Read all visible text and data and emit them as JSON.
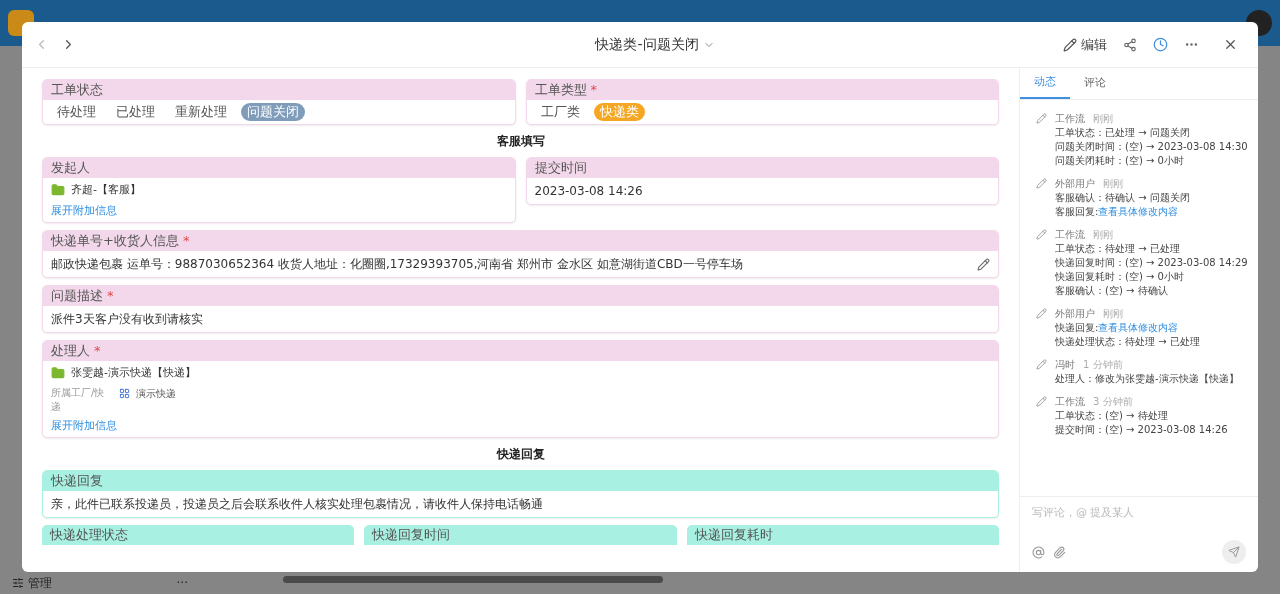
{
  "background": {
    "footer_label": "管理",
    "footer_more": "···"
  },
  "modal": {
    "title": "快递类-问题关闭",
    "edit": "编辑"
  },
  "form": [
    {
      "kind": "row",
      "fields": [
        {
          "kind": "options",
          "label": "工单状态",
          "color": "#f2d8ea",
          "options": [
            {
              "label": "待处理",
              "selected": false
            },
            {
              "label": "已处理",
              "selected": false
            },
            {
              "label": "重新处理",
              "selected": false
            },
            {
              "label": "问题关闭",
              "selected": true,
              "color": "#7f9dbb"
            }
          ]
        },
        {
          "kind": "options",
          "label": "工单类型",
          "required_mark": "*",
          "color": "#f2d8ea",
          "options": [
            {
              "label": "工厂类",
              "selected": false
            },
            {
              "label": "快递类",
              "selected": true,
              "color": "#f5a623"
            }
          ]
        }
      ]
    },
    {
      "kind": "heading",
      "text": "客服填写"
    },
    {
      "kind": "row",
      "fields": [
        {
          "kind": "person",
          "label": "发起人",
          "color": "#f2d8ea",
          "name": "齐超-【客服】",
          "link": "展开附加信息"
        },
        {
          "kind": "text",
          "label": "提交时间",
          "color": "#f2d8ea",
          "value": "2023-03-08 14:26"
        }
      ]
    },
    {
      "kind": "row",
      "fields": [
        {
          "kind": "text",
          "label": "快递单号+收货人信息",
          "required_mark": "*",
          "color": "#f2d8ea",
          "value": "邮政快递包裹 运单号：9887030652364 收货人地址：化圈圈,17329393705,河南省 郑州市 金水区 如意湖街道CBD一号停车场",
          "editable": true
        }
      ]
    },
    {
      "kind": "row",
      "fields": [
        {
          "kind": "text",
          "label": "问题描述",
          "required_mark": "*",
          "color": "#f2d8ea",
          "value": "派件3天客户没有收到请核实"
        }
      ]
    },
    {
      "kind": "row",
      "fields": [
        {
          "kind": "person",
          "label": "处理人",
          "required_mark": "*",
          "color": "#f2d8ea",
          "name": "张雯越-演示快递【快递】",
          "extra_label": "所属工厂/快递",
          "extra_value": "演示快递",
          "link": "展开附加信息"
        }
      ]
    },
    {
      "kind": "heading",
      "text": "快递回复"
    },
    {
      "kind": "row",
      "fields": [
        {
          "kind": "text",
          "label": "快递回复",
          "color": "#a8f0e2",
          "value": "亲，此件已联系投递员，投递员之后会联系收件人核实处理包裹情况，请收件人保持电话畅通"
        }
      ]
    },
    {
      "kind": "row",
      "fields": [
        {
          "kind": "label",
          "label": "快递处理状态",
          "color": "#a8f0e2"
        },
        {
          "kind": "label",
          "label": "快递回复时间",
          "color": "#a8f0e2"
        },
        {
          "kind": "label",
          "label": "快递回复耗时",
          "color": "#a8f0e2"
        }
      ]
    }
  ],
  "panel": {
    "tabs": [
      {
        "label": "动态",
        "selected": true
      },
      {
        "label": "评论",
        "selected": false
      }
    ],
    "activity": [
      {
        "author": "工作流",
        "time": "刚刚",
        "lines": [
          {
            "text": "工单状态：已处理 → 问题关闭"
          },
          {
            "text": "问题关闭时间：(空) → 2023-03-08 14:30"
          },
          {
            "text": "问题关闭耗时：(空) → 0小时"
          }
        ]
      },
      {
        "author": "外部用户",
        "time": "刚刚",
        "lines": [
          {
            "text": "客服确认：待确认 → 问题关闭"
          },
          {
            "text": "客服回复: ",
            "link": "查看具体修改内容"
          }
        ]
      },
      {
        "author": "工作流",
        "time": "刚刚",
        "lines": [
          {
            "text": "工单状态：待处理 → 已处理"
          },
          {
            "text": "快递回复时间：(空) → 2023-03-08 14:29"
          },
          {
            "text": "快递回复耗时：(空) → 0小时"
          },
          {
            "text": "客服确认：(空) → 待确认"
          }
        ]
      },
      {
        "author": "外部用户",
        "time": "刚刚",
        "lines": [
          {
            "text": "快递回复: ",
            "link": "查看具体修改内容"
          },
          {
            "text": "快递处理状态：待处理 → 已处理"
          }
        ]
      },
      {
        "author": "冯时",
        "time": "1 分钟前",
        "lines": [
          {
            "text": "处理人：修改为张雯越-演示快递【快递】"
          }
        ]
      },
      {
        "author": "工作流",
        "time": "3 分钟前",
        "lines": [
          {
            "text": "工单状态：(空) → 待处理"
          },
          {
            "text": "提交时间：(空) → 2023-03-08 14:26"
          }
        ]
      }
    ],
    "comment_placeholder": "写评论，@ 提及某人"
  }
}
